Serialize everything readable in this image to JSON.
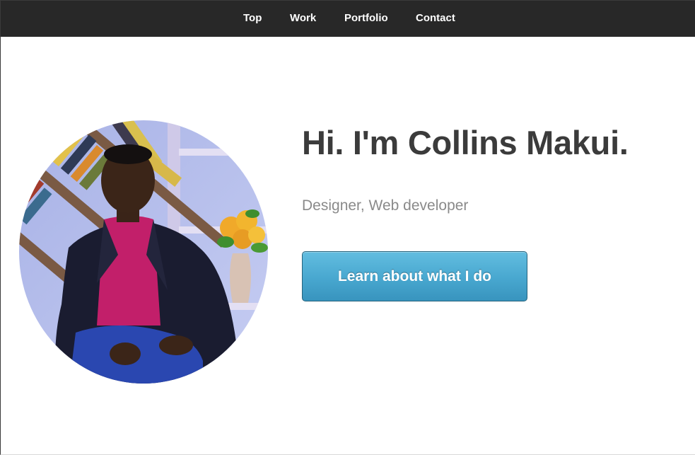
{
  "nav": {
    "items": [
      {
        "label": "Top"
      },
      {
        "label": "Work"
      },
      {
        "label": "Portfolio"
      },
      {
        "label": "Contact"
      }
    ]
  },
  "hero": {
    "greeting_prefix": "Hi. I'm ",
    "name": "Collins Makui",
    "greeting_suffix": ".",
    "subtitle": "Designer, Web developer",
    "cta_label": "Learn about what I do"
  },
  "colors": {
    "nav_background": "#282828",
    "cta_blue": "#48a7cf",
    "headline_text": "#3b3b3b",
    "subtitle_text": "#8a8a8a"
  }
}
